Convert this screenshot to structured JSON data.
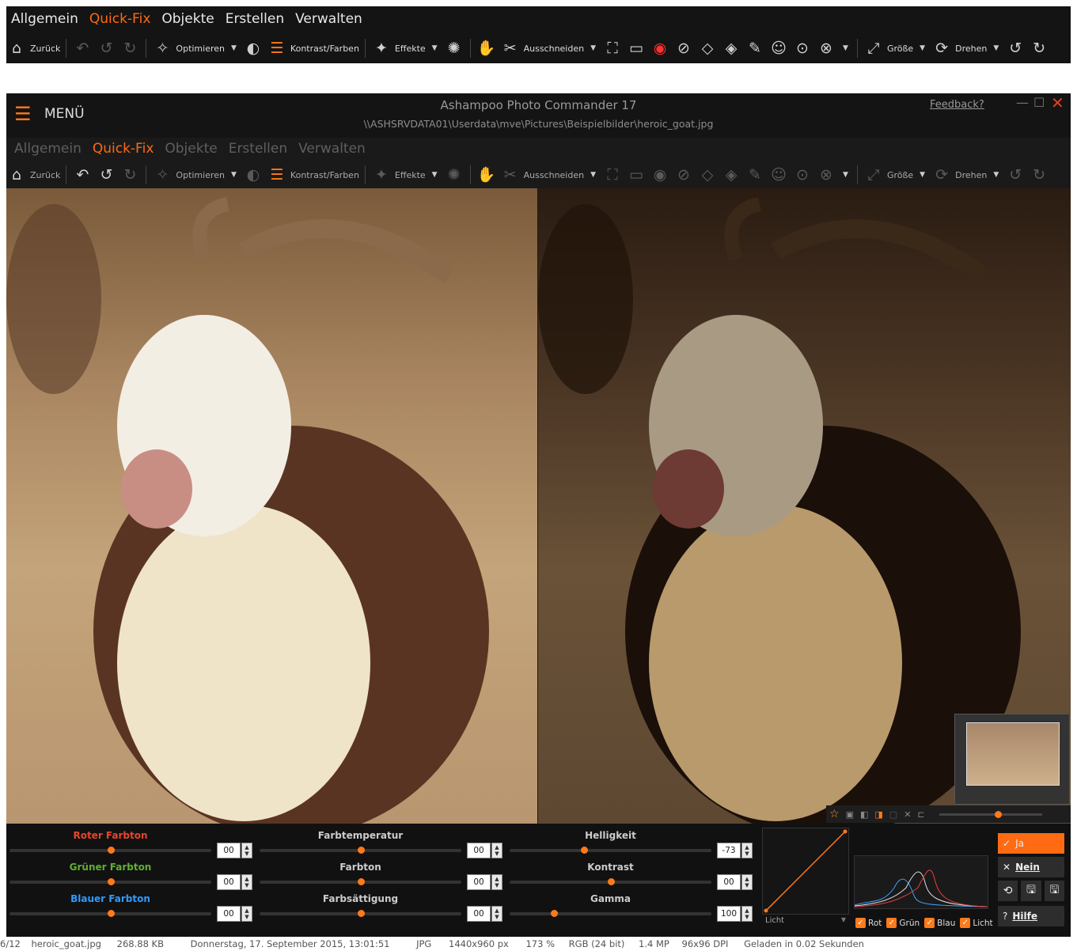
{
  "top_ribbon": {
    "tabs": [
      "Allgemein",
      "Quick-Fix",
      "Objekte",
      "Erstellen",
      "Verwalten"
    ],
    "active_tab": "Quick-Fix",
    "toolbar": {
      "back": "Zurück",
      "optimize": "Optimieren",
      "contrast_colors": "Kontrast/Farben",
      "effects": "Effekte",
      "cut": "Ausschneiden",
      "size": "Größe",
      "rotate": "Drehen"
    }
  },
  "window": {
    "menu_label": "MENÜ",
    "app_title": "Ashampoo Photo Commander 17",
    "file_path": "\\\\ASHSRVDATA01\\Userdata\\mve\\Pictures\\Beispielbilder\\heroic_goat.jpg",
    "feedback": "Feedback?",
    "tabs": [
      "Allgemein",
      "Quick-Fix",
      "Objekte",
      "Erstellen",
      "Verwalten"
    ],
    "toolbar": {
      "back": "Zurück",
      "optimize": "Optimieren",
      "contrast_colors": "Kontrast/Farben",
      "effects": "Effekte",
      "cut": "Ausschneiden",
      "size": "Größe",
      "rotate": "Drehen"
    }
  },
  "adjustments": {
    "red_hue": {
      "label": "Roter Farbton",
      "value": "00",
      "level": 0.5
    },
    "green_hue": {
      "label": "Grüner Farbton",
      "value": "00",
      "level": 0.5
    },
    "blue_hue": {
      "label": "Blauer Farbton",
      "value": "00",
      "level": 0.5
    },
    "temperature": {
      "label": "Farbtemperatur",
      "value": "00",
      "level": 0.5
    },
    "hue": {
      "label": "Farbton",
      "value": "00",
      "level": 0.5
    },
    "saturation": {
      "label": "Farbsättigung",
      "value": "00",
      "level": 0.5
    },
    "brightness": {
      "label": "Helligkeit",
      "value": "-73",
      "level": 0.37
    },
    "contrast": {
      "label": "Kontrast",
      "value": "00",
      "level": 0.5
    },
    "gamma": {
      "label": "Gamma",
      "value": "100",
      "level": 0.22
    }
  },
  "curve": {
    "channel": "Licht"
  },
  "histogram": {
    "channels": [
      {
        "label": "Rot",
        "checked": true,
        "color": "#e04040"
      },
      {
        "label": "Grün",
        "checked": true,
        "color": "#e0e0e0"
      },
      {
        "label": "Blau",
        "checked": true,
        "color": "#3aa0ff"
      },
      {
        "label": "Licht",
        "checked": true,
        "color": "#ffffff"
      }
    ]
  },
  "actions": {
    "yes": "Ja",
    "no": "Nein",
    "help": "Hilfe"
  },
  "colors": {
    "accent": "#ff7a1a",
    "red_label": "#e8452b",
    "green_label": "#5fb030",
    "blue_label": "#2f9bff"
  },
  "status": {
    "index": "6/12",
    "file": "heroic_goat.jpg",
    "size": "268.88 KB",
    "date": "Donnerstag, 17. September 2015, 13:01:51",
    "format": "JPG",
    "dimensions": "1440x960 px",
    "zoom": "173 %",
    "color_mode": "RGB (24 bit)",
    "megapixels": "1.4 MP",
    "dpi": "96x96 DPI",
    "load_time": "Geladen in 0.02 Sekunden"
  }
}
